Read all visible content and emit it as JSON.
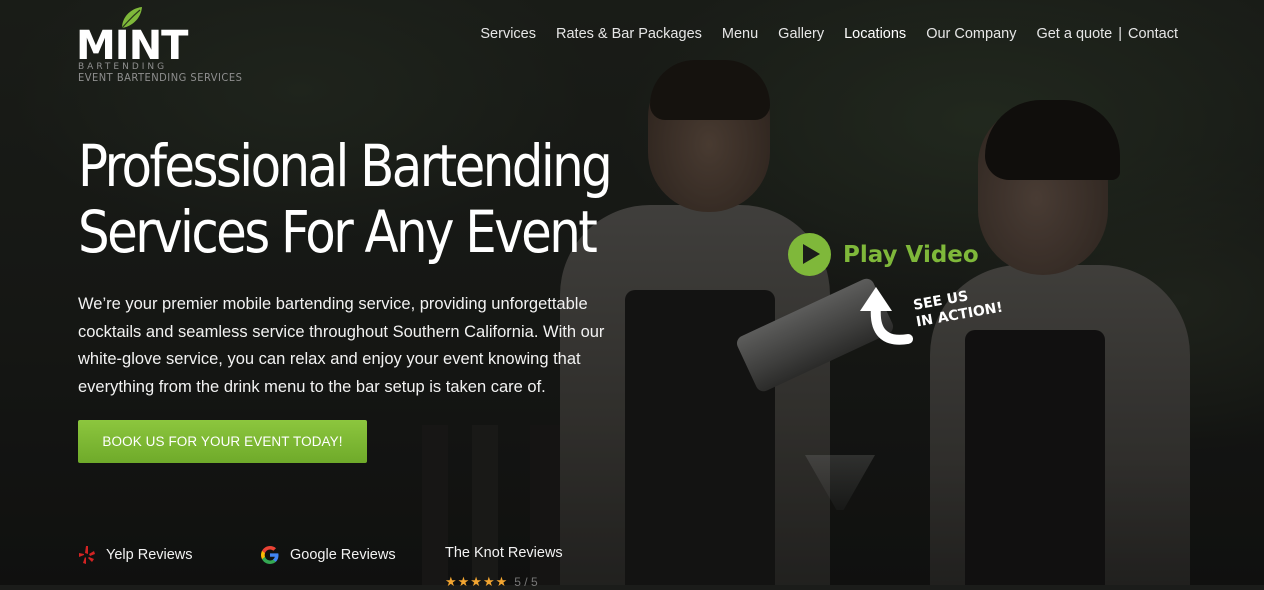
{
  "brand": {
    "name": "MINT",
    "sub_small": "BARTENDING",
    "sub_tagline": "EVENT BARTENDING SERVICES",
    "accent_color": "#7fb83a"
  },
  "nav": {
    "items": [
      "Services",
      "Rates & Bar Packages",
      "Menu",
      "Gallery",
      "Locations",
      "Our Company"
    ],
    "quote": "Get a quote",
    "separator": "|",
    "contact": "Contact",
    "active": "Locations"
  },
  "hero": {
    "title_line1": "Professional Bartending",
    "title_line2": "Services For Any Event",
    "paragraph": "We’re your premier mobile bartending service, providing unforgettable cocktails and seamless service throughout Southern California. With our white-glove service, you can relax and enjoy your event knowing that everything from the drink menu to the bar setup is taken care of.",
    "cta_label": "BOOK US FOR YOUR EVENT TODAY!"
  },
  "video": {
    "play_label": "Play Video",
    "see_us_line1": "SEE US",
    "see_us_line2": "IN ACTION!",
    "icon": "play-circle-icon"
  },
  "reviews": {
    "yelp": "Yelp Reviews",
    "google": "Google Reviews",
    "knot": "The Knot Reviews",
    "knot_stars": "★★★★★",
    "knot_rating": "5 / 5"
  }
}
